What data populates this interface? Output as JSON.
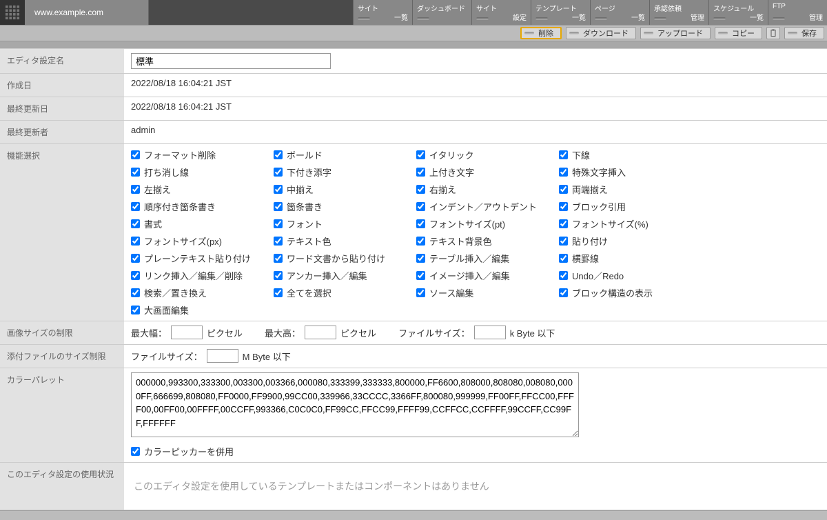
{
  "header": {
    "site_url": "www.example.com",
    "nav": [
      {
        "line1": "サイト",
        "line2": "一覧"
      },
      {
        "line1": "ダッシュボード",
        "line2": ""
      },
      {
        "line1": "サイト",
        "line2": "設定"
      },
      {
        "line1": "テンプレート",
        "line2": "一覧"
      },
      {
        "line1": "ページ",
        "line2": "一覧"
      },
      {
        "line1": "承認依頼",
        "line2": "管理"
      },
      {
        "line1": "スケジュール",
        "line2": "一覧"
      },
      {
        "line1": "FTP",
        "line2": "管理"
      }
    ]
  },
  "actions": {
    "delete": "削除",
    "download": "ダウンロード",
    "upload": "アップロード",
    "copy": "コピー",
    "save": "保存"
  },
  "form": {
    "name_label": "エディタ設定名",
    "name_value": "標準",
    "created_label": "作成日",
    "created_value": "2022/08/18 16:04:21 JST",
    "updated_label": "最終更新日",
    "updated_value": "2022/08/18 16:04:21 JST",
    "updater_label": "最終更新者",
    "updater_value": "admin",
    "features_label": "機能選択",
    "features": [
      "フォーマット削除",
      "ボールド",
      "イタリック",
      "下線",
      "打ち消し線",
      "下付き添字",
      "上付き文字",
      "特殊文字挿入",
      "左揃え",
      "中揃え",
      "右揃え",
      "両端揃え",
      "順序付き箇条書き",
      "箇条書き",
      "インデント／アウトデント",
      "ブロック引用",
      "書式",
      "フォント",
      "フォントサイズ(pt)",
      "フォントサイズ(%)",
      "フォントサイズ(px)",
      "テキスト色",
      "テキスト背景色",
      "貼り付け",
      "プレーンテキスト貼り付け",
      "ワード文書から貼り付け",
      "テーブル挿入／編集",
      "横罫線",
      "リンク挿入／編集／削除",
      "アンカー挿入／編集",
      "イメージ挿入／編集",
      "Undo／Redo",
      "検索／置き換え",
      "全てを選択",
      "ソース編集",
      "ブロック構造の表示",
      "大画面編集"
    ],
    "image_limit_label": "画像サイズの制限",
    "image_limit": {
      "max_width_label": "最大幅：",
      "px1": "ピクセル",
      "max_height_label": "最大高：",
      "px2": "ピクセル",
      "filesize_label": "ファイルサイズ：",
      "filesize_unit": "k Byte 以下"
    },
    "attach_limit_label": "添付ファイルのサイズ制限",
    "attach_limit": {
      "filesize_label": "ファイルサイズ：",
      "filesize_unit": "M Byte 以下"
    },
    "palette_label": "カラーパレット",
    "palette_value": "000000,993300,333300,003300,003366,000080,333399,333333,800000,FF6600,808000,808080,008080,0000FF,666699,808080,FF0000,FF9900,99CC00,339966,33CCCC,3366FF,800080,999999,FF00FF,FFCC00,FFFF00,00FF00,00FFFF,00CCFF,993366,C0C0C0,FF99CC,FFCC99,FFFF99,CCFFCC,CCFFFF,99CCFF,CC99FF,FFFFFF",
    "use_color_picker": "カラーピッカーを併用",
    "usage_label": "このエディタ設定の使用状況",
    "usage_msg": "このエディタ設定を使用しているテンプレートまたはコンポーネントはありません"
  }
}
